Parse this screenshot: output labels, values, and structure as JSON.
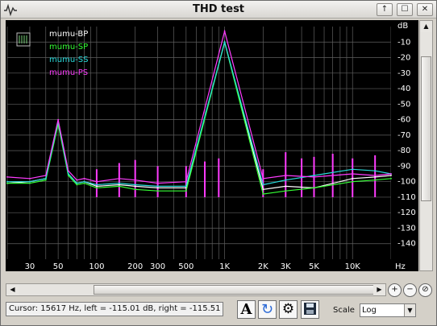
{
  "window": {
    "title": "THD test"
  },
  "titlebar": {
    "up_label": "↑",
    "restore_label": "☐",
    "close_label": "✕"
  },
  "plot": {
    "legend": [
      {
        "label": "mumu-BP",
        "color": "#ffffff"
      },
      {
        "label": "mumu-SP",
        "color": "#34ff34"
      },
      {
        "label": "mumu-SS",
        "color": "#28dcdc"
      },
      {
        "label": "mumu-PS",
        "color": "#ff3cff"
      }
    ],
    "y_axis_unit": "dB",
    "y_ticks": [
      "-10",
      "-20",
      "-30",
      "-40",
      "-50",
      "-60",
      "-70",
      "-80",
      "-90",
      "-100",
      "-110",
      "-120",
      "-130",
      "-140"
    ],
    "x_axis_unit": "Hz",
    "x_ticks": [
      "30",
      "50",
      "100",
      "200",
      "300",
      "500",
      "1K",
      "2K",
      "3K",
      "5K",
      "10K"
    ]
  },
  "statusbar": {
    "text": "Cursor: 15617 Hz, left = -115.01 dB, right = -115.51 dB"
  },
  "toolbar": {
    "font_icon_label": "A"
  },
  "scale": {
    "label": "Scale",
    "value": "Log"
  },
  "chart_data": {
    "type": "line",
    "xlabel": "Hz",
    "ylabel": "dB",
    "x_scale": "log",
    "xlim": [
      20,
      20000
    ],
    "ylim": [
      -150,
      0
    ],
    "grid": true,
    "legend_position": "top-left",
    "series": [
      {
        "name": "mumu-BP",
        "color": "#ffffff",
        "x": [
          20,
          30,
          40,
          50,
          60,
          70,
          80,
          100,
          150,
          200,
          300,
          500,
          1000,
          2000,
          3000,
          5000,
          10000,
          15000,
          20000
        ],
        "y": [
          -101,
          -100,
          -98,
          -62,
          -95,
          -101,
          -100,
          -103,
          -102,
          -103,
          -104,
          -104,
          -10,
          -105,
          -103,
          -104,
          -98,
          -97,
          -96
        ]
      },
      {
        "name": "mumu-SP",
        "color": "#34ff34",
        "x": [
          20,
          30,
          40,
          50,
          60,
          70,
          80,
          100,
          150,
          200,
          300,
          500,
          1000,
          2000,
          3000,
          5000,
          10000,
          15000,
          20000
        ],
        "y": [
          -101,
          -101,
          -99,
          -63,
          -96,
          -102,
          -101,
          -104,
          -103,
          -105,
          -106,
          -106,
          -10,
          -108,
          -106,
          -104,
          -100,
          -99,
          -98
        ]
      },
      {
        "name": "mumu-SS",
        "color": "#28dcdc",
        "x": [
          20,
          30,
          40,
          50,
          60,
          70,
          80,
          100,
          150,
          200,
          300,
          500,
          1000,
          2000,
          3000,
          5000,
          10000,
          15000,
          20000
        ],
        "y": [
          -100,
          -100,
          -98,
          -61,
          -95,
          -101,
          -100,
          -102,
          -101,
          -102,
          -103,
          -103,
          -10,
          -102,
          -99,
          -96,
          -92,
          -93,
          -95
        ]
      },
      {
        "name": "mumu-PS",
        "color": "#ff3cff",
        "x": [
          20,
          30,
          40,
          50,
          60,
          70,
          80,
          100,
          150,
          200,
          300,
          500,
          1000,
          2000,
          3000,
          5000,
          10000,
          15000,
          20000
        ],
        "y": [
          -97,
          -98,
          -96,
          -60,
          -93,
          -99,
          -98,
          -100,
          -98,
          -99,
          -101,
          -100,
          -3,
          -98,
          -96,
          -97,
          -95,
          -96,
          -95
        ]
      }
    ],
    "spikes": [
      {
        "x": 100,
        "y": -92
      },
      {
        "x": 150,
        "y": -88
      },
      {
        "x": 200,
        "y": -86
      },
      {
        "x": 300,
        "y": -90
      },
      {
        "x": 500,
        "y": -90
      },
      {
        "x": 700,
        "y": -87
      },
      {
        "x": 900,
        "y": -85
      },
      {
        "x": 2000,
        "y": -92
      },
      {
        "x": 3000,
        "y": -81
      },
      {
        "x": 4000,
        "y": -85
      },
      {
        "x": 5000,
        "y": -84
      },
      {
        "x": 7000,
        "y": -82
      },
      {
        "x": 10000,
        "y": -85
      },
      {
        "x": 15000,
        "y": -83
      }
    ]
  }
}
